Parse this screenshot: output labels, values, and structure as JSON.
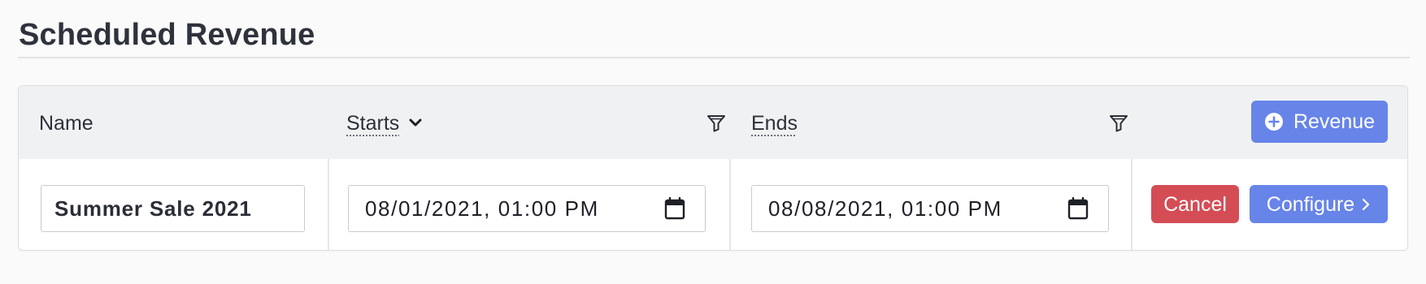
{
  "page": {
    "title": "Scheduled Revenue"
  },
  "table": {
    "columns": [
      {
        "label": "Name",
        "sortable": false,
        "filterable": false
      },
      {
        "label": "Starts",
        "sortable": true,
        "sort_direction": "descending",
        "filterable": true
      },
      {
        "label": "Ends",
        "sortable": true,
        "filterable": true
      }
    ],
    "add_button_label": "Revenue",
    "rows": [
      {
        "name": "Summer Sale 2021",
        "starts": "08/01/2021, 01:00 PM",
        "ends": "08/08/2021, 01:00 PM",
        "cancel_label": "Cancel",
        "configure_label": "Configure"
      }
    ]
  },
  "icons": {
    "sort": "chevron-down-icon",
    "filter": "filter-funnel-icon",
    "add": "plus-circle-icon",
    "calendar": "calendar-icon",
    "configure": "chevron-right-icon"
  },
  "colors": {
    "primary": "#6784e8",
    "danger": "#d44d55",
    "header_bg": "#f0f1f3",
    "page_bg": "#fafafa"
  }
}
